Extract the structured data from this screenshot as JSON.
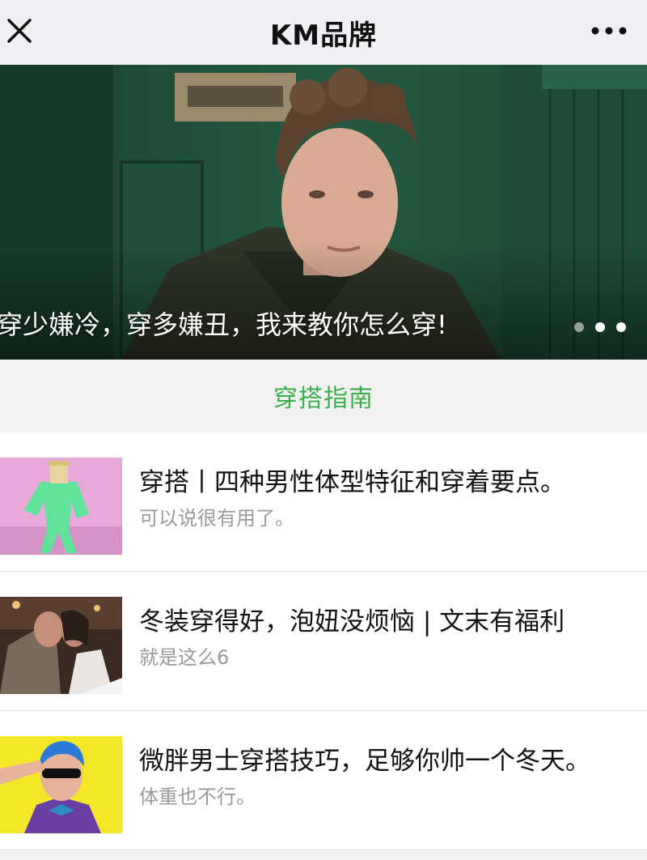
{
  "header": {
    "title": "KM品牌",
    "close_icon": "close-icon",
    "more_icon": "more-dots-icon"
  },
  "banner": {
    "caption": "穿少嫌冷，穿多嫌丑，我来教你怎么穿!",
    "slide_count": 3,
    "active_slide": 1
  },
  "section": {
    "title": "穿搭指南",
    "accent_color": "#3bb04a"
  },
  "articles": [
    {
      "title": "穿搭丨四种男性体型特征和穿着要点。",
      "subtitle": "可以说很有用了。"
    },
    {
      "title": "冬装穿得好，泡妞没烦恼 | 文末有福利",
      "subtitle": "就是这么6"
    },
    {
      "title": "微胖男士穿搭技巧，足够你帅一个冬天。",
      "subtitle": "体重也不行。"
    }
  ]
}
